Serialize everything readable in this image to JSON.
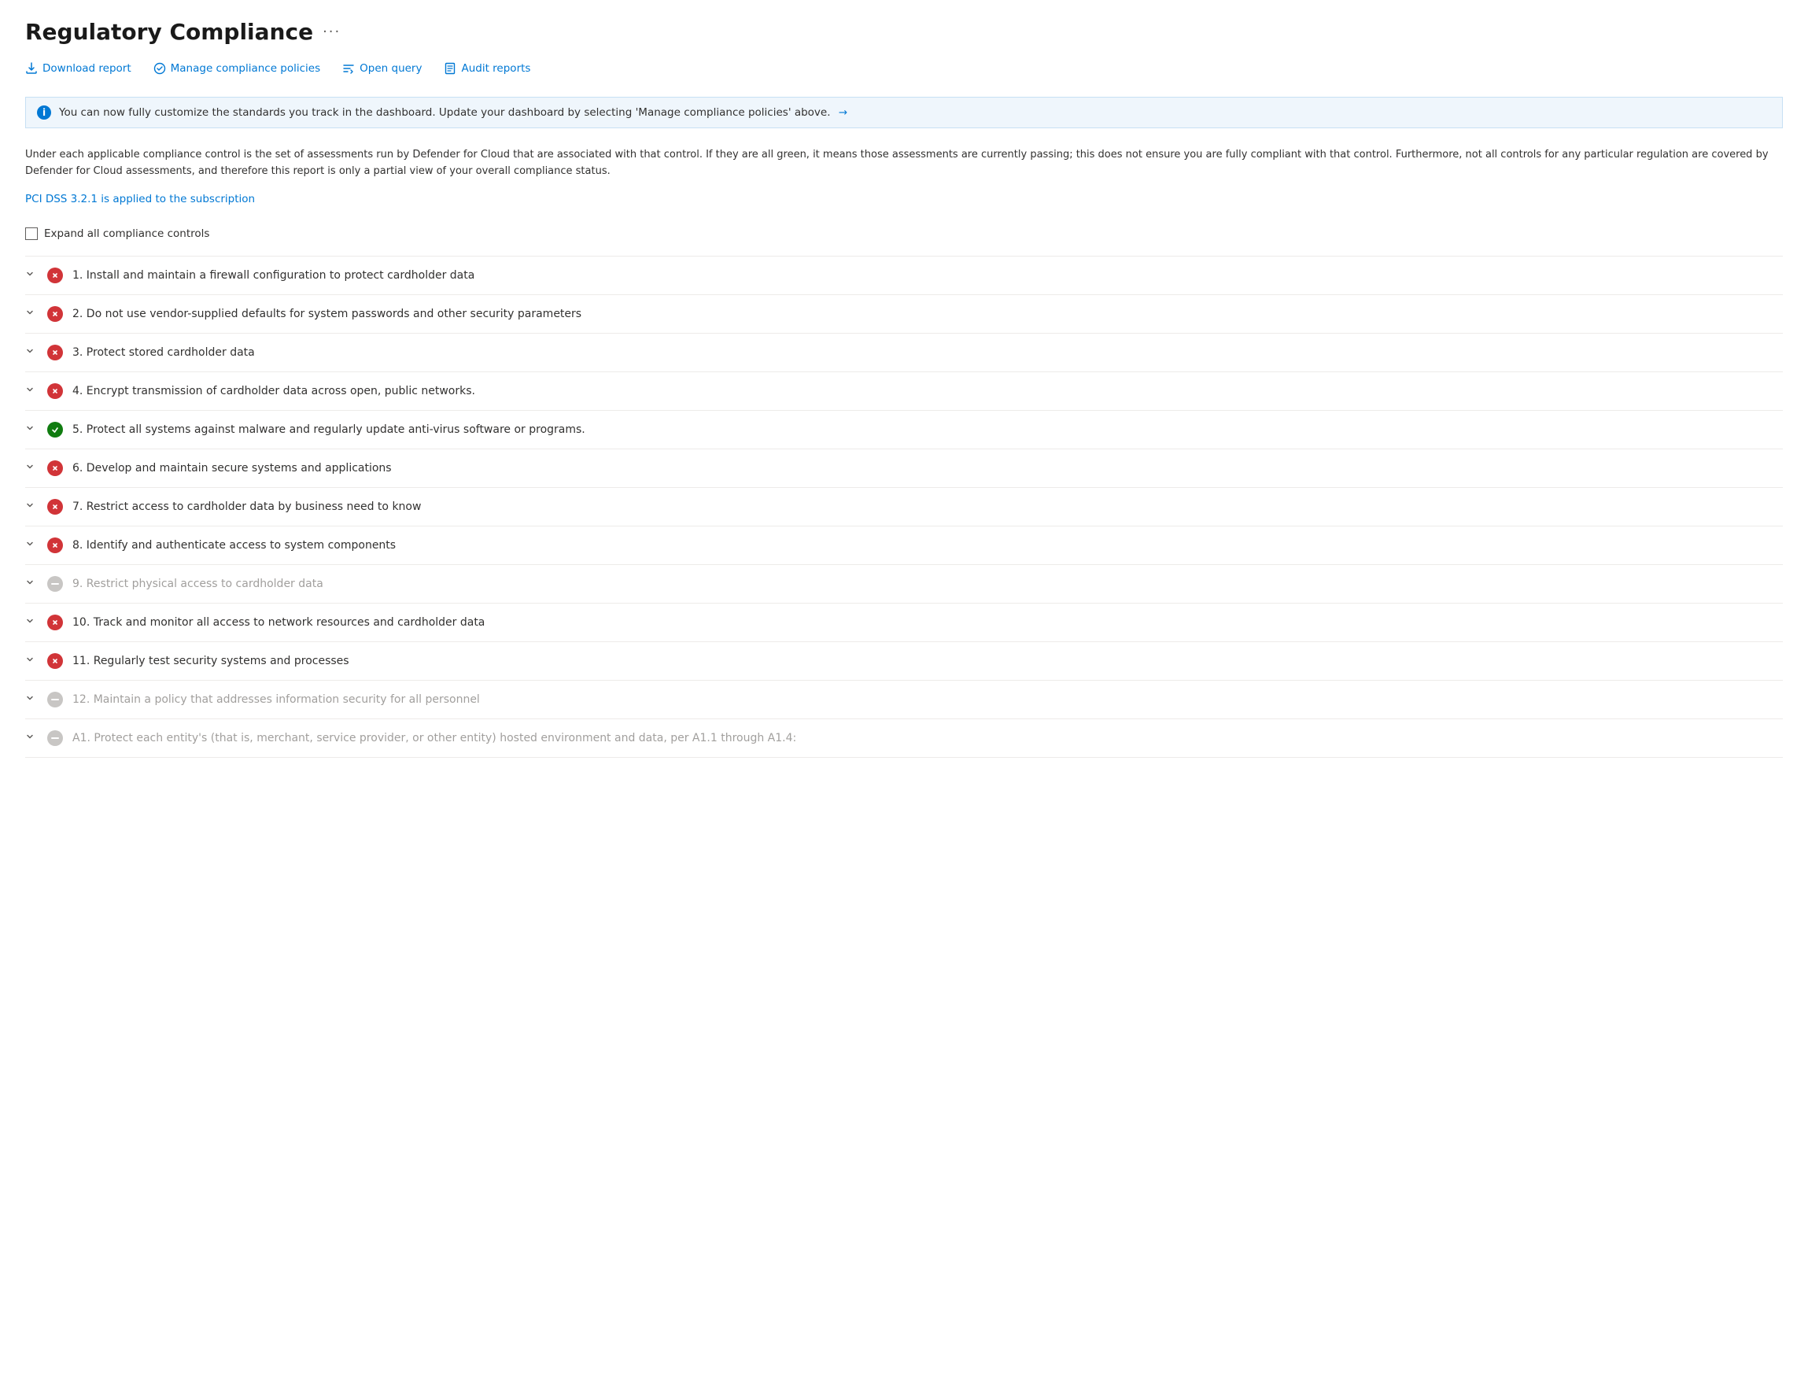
{
  "page": {
    "title": "Regulatory Compliance",
    "ellipsis": "···"
  },
  "toolbar": {
    "download_label": "Download report",
    "manage_label": "Manage compliance policies",
    "query_label": "Open query",
    "audit_label": "Audit reports"
  },
  "banner": {
    "text": "You can now fully customize the standards you track in the dashboard. Update your dashboard by selecting 'Manage compliance policies' above.",
    "arrow": "→"
  },
  "description": "Under each applicable compliance control is the set of assessments run by Defender for Cloud that are associated with that control. If they are all green, it means those assessments are currently passing; this does not ensure you are fully compliant with that control. Furthermore, not all controls for any particular regulation are covered by Defender for Cloud assessments, and therefore this report is only a partial view of your overall compliance status.",
  "pci_link": "PCI DSS 3.2.1 is applied to the subscription",
  "expand_label": "Expand all compliance controls",
  "items": [
    {
      "id": 1,
      "status": "red",
      "label": "1. Install and maintain a firewall configuration to protect cardholder data",
      "gray": false
    },
    {
      "id": 2,
      "status": "red",
      "label": "2. Do not use vendor-supplied defaults for system passwords and other security parameters",
      "gray": false
    },
    {
      "id": 3,
      "status": "red",
      "label": "3. Protect stored cardholder data",
      "gray": false
    },
    {
      "id": 4,
      "status": "red",
      "label": "4. Encrypt transmission of cardholder data across open, public networks.",
      "gray": false
    },
    {
      "id": 5,
      "status": "green",
      "label": "5. Protect all systems against malware and regularly update anti-virus software or programs.",
      "gray": false
    },
    {
      "id": 6,
      "status": "red",
      "label": "6. Develop and maintain secure systems and applications",
      "gray": false
    },
    {
      "id": 7,
      "status": "red",
      "label": "7. Restrict access to cardholder data by business need to know",
      "gray": false
    },
    {
      "id": 8,
      "status": "red",
      "label": "8. Identify and authenticate access to system components",
      "gray": false
    },
    {
      "id": 9,
      "status": "gray",
      "label": "9. Restrict physical access to cardholder data",
      "gray": true
    },
    {
      "id": 10,
      "status": "red",
      "label": "10. Track and monitor all access to network resources and cardholder data",
      "gray": false
    },
    {
      "id": 11,
      "status": "red",
      "label": "11. Regularly test security systems and processes",
      "gray": false
    },
    {
      "id": 12,
      "status": "gray",
      "label": "12. Maintain a policy that addresses information security for all personnel",
      "gray": true
    },
    {
      "id": 13,
      "status": "gray",
      "label": "A1. Protect each entity's (that is, merchant, service provider, or other entity) hosted environment and data, per A1.1 through A1.4:",
      "gray": true
    }
  ]
}
